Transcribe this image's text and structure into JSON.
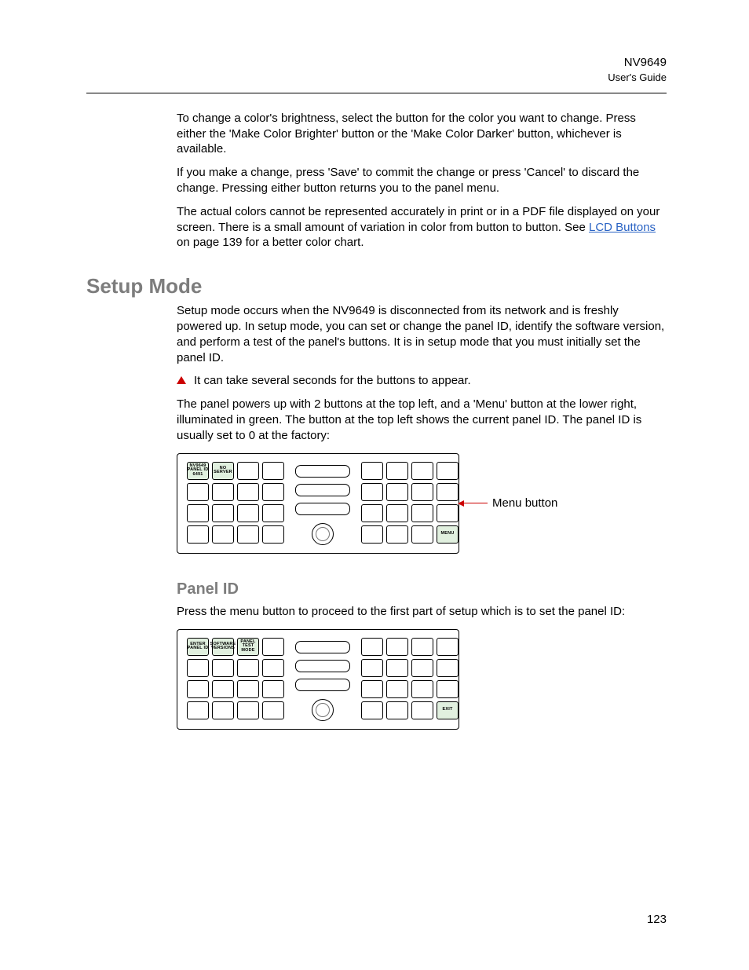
{
  "header": {
    "product": "NV9649",
    "subtitle": "User's Guide"
  },
  "intro": {
    "p1": "To change a color's brightness, select the button for the color you want to change. Press either the 'Make Color Brighter' button or the 'Make Color Darker' button, whichever is available.",
    "p2": "If you make a change, press 'Save' to commit the change or press 'Cancel' to discard the change. Pressing either button returns you to the panel menu.",
    "p3a": "The actual colors cannot be represented accurately in print or in a PDF file displayed on your screen. There is a small amount of variation in color from button to button. See ",
    "p3link": "LCD Buttons",
    "p3b": " on page 139 for a better color chart."
  },
  "setup": {
    "title": "Setup Mode",
    "p1": "Setup mode occurs when the NV9649 is disconnected from its network and is freshly powered up. In setup mode, you can set or change the panel ID, identify the software version, and perform a test of the panel's buttons. It is in setup mode that you must initially set the panel ID.",
    "note": "It can take several seconds for the buttons to appear.",
    "p2": "The panel powers up with 2 buttons at the top left, and a 'Menu' button at the lower right, illuminated in green. The button at the top left shows the current panel ID. The panel ID is usually set to 0 at the factory:"
  },
  "panel1": {
    "btn_tl1": "NV9649\nPANEL ID\n6491",
    "btn_tl2": "NO\nSERVER",
    "btn_menu": "MENU",
    "callout": "Menu button"
  },
  "panelid": {
    "title": "Panel ID",
    "p1": "Press the menu button to proceed to the first part of setup which is to set the panel ID:"
  },
  "panel2": {
    "btn1": "ENTER\nPANEL ID",
    "btn2": "SOFTWARE\nVERSIONS",
    "btn3": "PANEL\nTEST\nMODE",
    "btn_exit": "EXIT"
  },
  "page_number": "123"
}
